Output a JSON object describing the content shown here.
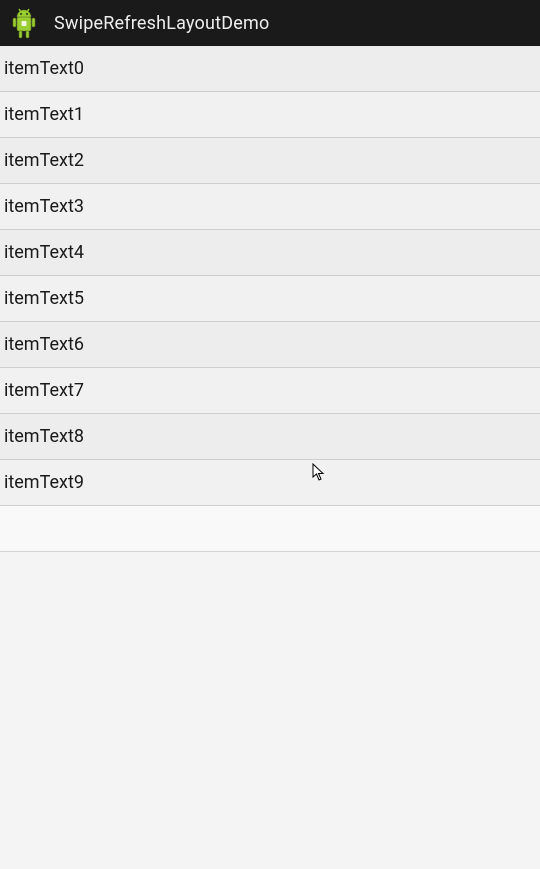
{
  "header": {
    "title": "SwipeRefreshLayoutDemo"
  },
  "list": {
    "items": [
      {
        "label": "itemText0"
      },
      {
        "label": "itemText1"
      },
      {
        "label": "itemText2"
      },
      {
        "label": "itemText3"
      },
      {
        "label": "itemText4"
      },
      {
        "label": "itemText5"
      },
      {
        "label": "itemText6"
      },
      {
        "label": "itemText7"
      },
      {
        "label": "itemText8"
      },
      {
        "label": "itemText9"
      }
    ]
  }
}
